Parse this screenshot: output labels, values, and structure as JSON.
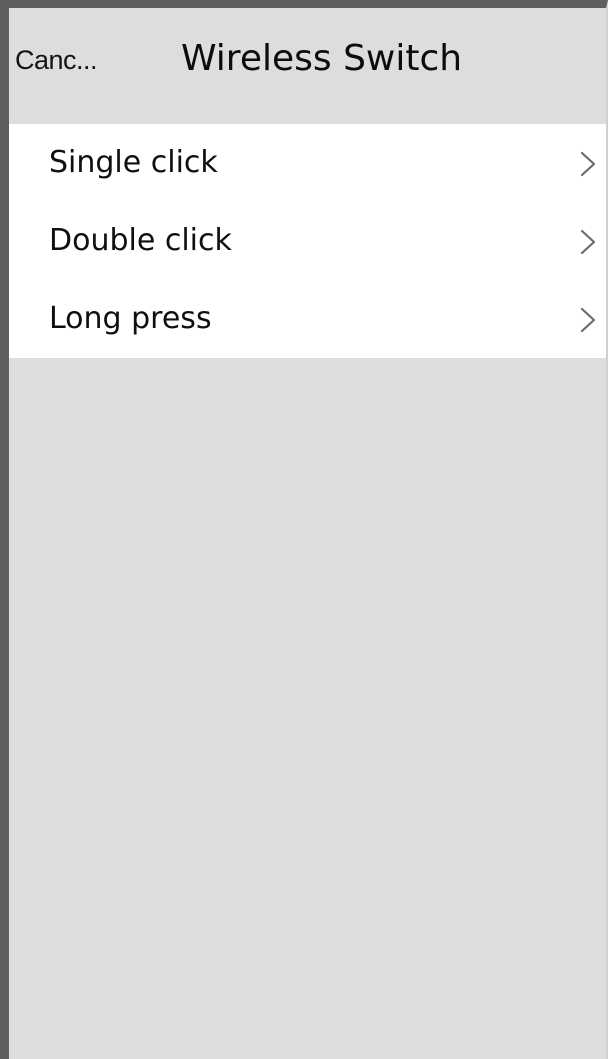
{
  "header": {
    "cancel_label": "Canc...",
    "title": "Wireless Switch"
  },
  "list": {
    "items": [
      {
        "label": "Single click",
        "icon": "chevron-right-icon"
      },
      {
        "label": "Double click",
        "icon": "chevron-right-icon"
      },
      {
        "label": "Long press",
        "icon": "chevron-right-icon"
      }
    ]
  },
  "colors": {
    "background": "#dddddd",
    "list_background": "#ffffff",
    "text": "#101010",
    "chevron": "#6b6b6b"
  }
}
